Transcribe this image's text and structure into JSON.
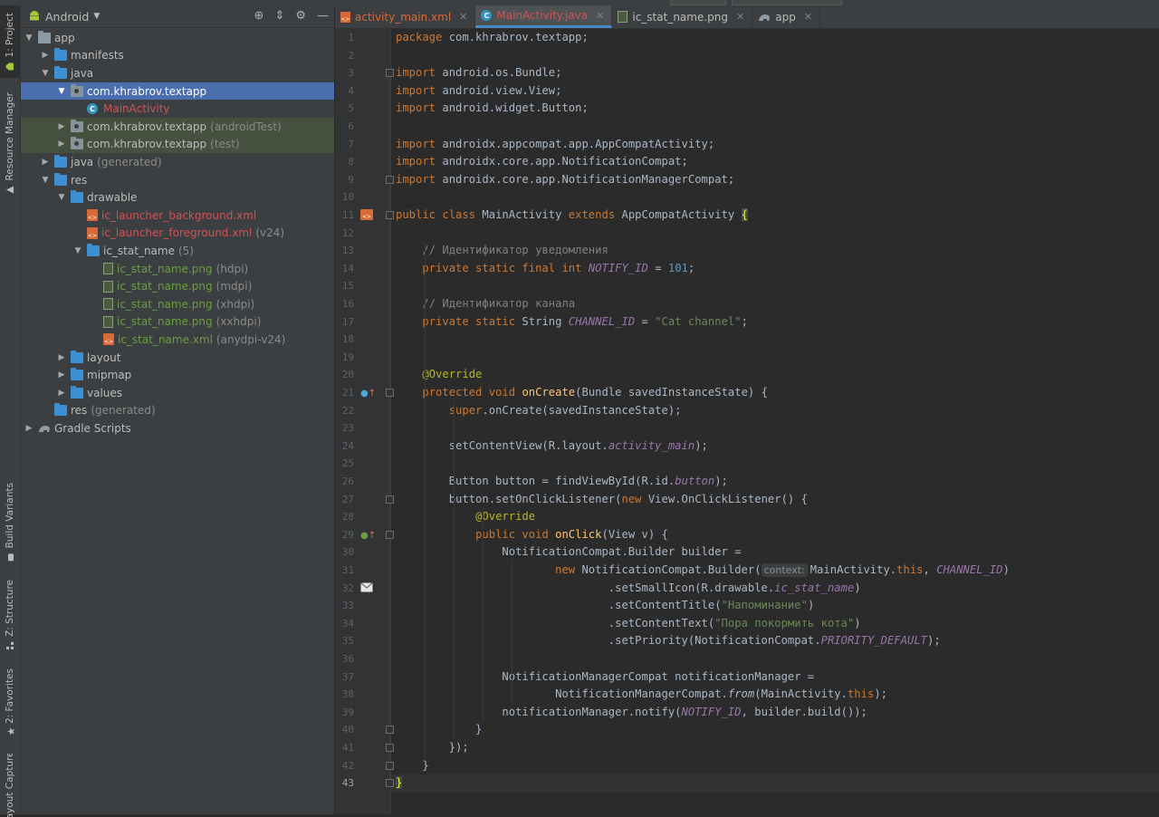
{
  "left_tool_tabs": [
    "1: Project",
    "Resource Manager",
    "Build Variants",
    "Z: Structure",
    "2: Favorites",
    "Layout Captures"
  ],
  "project_panel": {
    "view_mode": "Android",
    "tree": [
      {
        "label": "app",
        "depth": 0,
        "icon": "module-folder-icon",
        "expanded": true
      },
      {
        "label": "manifests",
        "depth": 1,
        "icon": "folder-icon",
        "expanded": false
      },
      {
        "label": "java",
        "depth": 1,
        "icon": "folder-icon",
        "expanded": true
      },
      {
        "label": "com.khrabrov.textapp",
        "depth": 2,
        "icon": "package-icon",
        "expanded": true,
        "selected": true
      },
      {
        "label": "MainActivity",
        "depth": 3,
        "icon": "class-icon",
        "color": "red"
      },
      {
        "label": "com.khrabrov.textapp",
        "suffix": "(androidTest)",
        "depth": 2,
        "icon": "package-icon",
        "expanded": false,
        "highlight": true
      },
      {
        "label": "com.khrabrov.textapp",
        "suffix": "(test)",
        "depth": 2,
        "icon": "package-icon",
        "expanded": false,
        "highlight": true
      },
      {
        "label": "java",
        "suffix": "(generated)",
        "depth": 1,
        "icon": "generated-folder-icon",
        "expanded": false
      },
      {
        "label": "res",
        "depth": 1,
        "icon": "folder-icon",
        "expanded": true
      },
      {
        "label": "drawable",
        "depth": 2,
        "icon": "folder-icon",
        "expanded": true
      },
      {
        "label": "ic_launcher_background.xml",
        "depth": 3,
        "icon": "xml-file-icon",
        "color": "red"
      },
      {
        "label": "ic_launcher_foreground.xml",
        "suffix": "(v24)",
        "depth": 3,
        "icon": "xml-file-icon",
        "color": "red"
      },
      {
        "label": "ic_stat_name",
        "suffix": "(5)",
        "depth": 3,
        "icon": "folder-icon",
        "expanded": true
      },
      {
        "label": "ic_stat_name.png",
        "suffix": "(hdpi)",
        "depth": 4,
        "icon": "png-file-icon",
        "color": "green"
      },
      {
        "label": "ic_stat_name.png",
        "suffix": "(mdpi)",
        "depth": 4,
        "icon": "png-file-icon",
        "color": "green"
      },
      {
        "label": "ic_stat_name.png",
        "suffix": "(xhdpi)",
        "depth": 4,
        "icon": "png-file-icon",
        "color": "green"
      },
      {
        "label": "ic_stat_name.png",
        "suffix": "(xxhdpi)",
        "depth": 4,
        "icon": "png-file-icon",
        "color": "green"
      },
      {
        "label": "ic_stat_name.xml",
        "suffix": "(anydpi-v24)",
        "depth": 4,
        "icon": "xml-file-icon",
        "color": "green"
      },
      {
        "label": "layout",
        "depth": 2,
        "icon": "folder-icon",
        "expanded": false
      },
      {
        "label": "mipmap",
        "depth": 2,
        "icon": "folder-icon",
        "expanded": false
      },
      {
        "label": "values",
        "depth": 2,
        "icon": "folder-icon",
        "expanded": false
      },
      {
        "label": "res",
        "suffix": "(generated)",
        "depth": 1,
        "icon": "generated-folder-icon"
      },
      {
        "label": "Gradle Scripts",
        "depth": 0,
        "icon": "gradle-icon",
        "expanded": false
      }
    ]
  },
  "editor_tabs": [
    {
      "label": "activity_main.xml",
      "icon": "xml-file-icon",
      "color": "#d76a37"
    },
    {
      "label": "MainActivity.java",
      "icon": "class-icon",
      "color": "#d25252",
      "active": true
    },
    {
      "label": "ic_stat_name.png",
      "icon": "png-file-icon",
      "color": "#bbbbbb"
    },
    {
      "label": "app",
      "icon": "gradle-icon",
      "color": "#bbbbbb"
    }
  ],
  "current_line": 43,
  "code_lines": [
    "<k>package</k> com.khrabrov.textapp;",
    "",
    "<k>import</k> android.os.Bundle;",
    "<k>import</k> android.view.View;",
    "<k>import</k> android.widget.Button;",
    "",
    "<k>import</k> androidx.appcompat.app.AppCompatActivity;",
    "<k>import</k> androidx.core.app.NotificationCompat;",
    "<k>import</k> androidx.core.app.NotificationManagerCompat;",
    "",
    "<k>public class</k> MainActivity <k>extends</k> AppCompatActivity <b>{</b>",
    "",
    "    <c>// Идентификатор уведомления</c>",
    "    <k>private static final int</k> <f>NOTIFY_ID</f> = <n>101</n>;",
    "",
    "    <c>// Идентификатор канала</c>",
    "    <k>private static</k> String <f>CHANNEL_ID</f> = <s>\"Cat channel\"</s>;",
    "",
    "",
    "    <a>@Override</a>",
    "    <k>protected void</k> <m>onCreate</m>(Bundle savedInstanceState) {",
    "        <k>super</k>.onCreate(savedInstanceState);",
    "",
    "        setContentView(R.layout.<f>activity_main</f>);",
    "",
    "        Button button = findViewById(R.id.<f>button</f>);",
    "        button.setOnClickListener(<k>new</k> View.OnClickListener() {",
    "            <a>@Override</a>",
    "            <k>public void</k> <m>onClick</m>(View v) {",
    "                NotificationCompat.Builder builder =",
    "                        <k>new</k> NotificationCompat.Builder(<h>context:</h>MainActivity.<k>this</k>, <f>CHANNEL_ID</f>)",
    "                                .setSmallIcon(R.drawable.<f>ic_stat_name</f>)",
    "                                .setContentTitle(<s>\"Напоминание\"</s>)",
    "                                .setContentText(<s>\"Пора покормить кота\"</s>)",
    "                                .setPriority(NotificationCompat.<f>PRIORITY_DEFAULT</f>);",
    "",
    "                NotificationManagerCompat notificationManager =",
    "                        NotificationManagerCompat.<i>from</i>(MainActivity.<k>this</k>);",
    "                notificationManager.notify(<f>NOTIFY_ID</f>, builder.build());",
    "            }",
    "        });",
    "    }",
    "<b>}</b>"
  ]
}
